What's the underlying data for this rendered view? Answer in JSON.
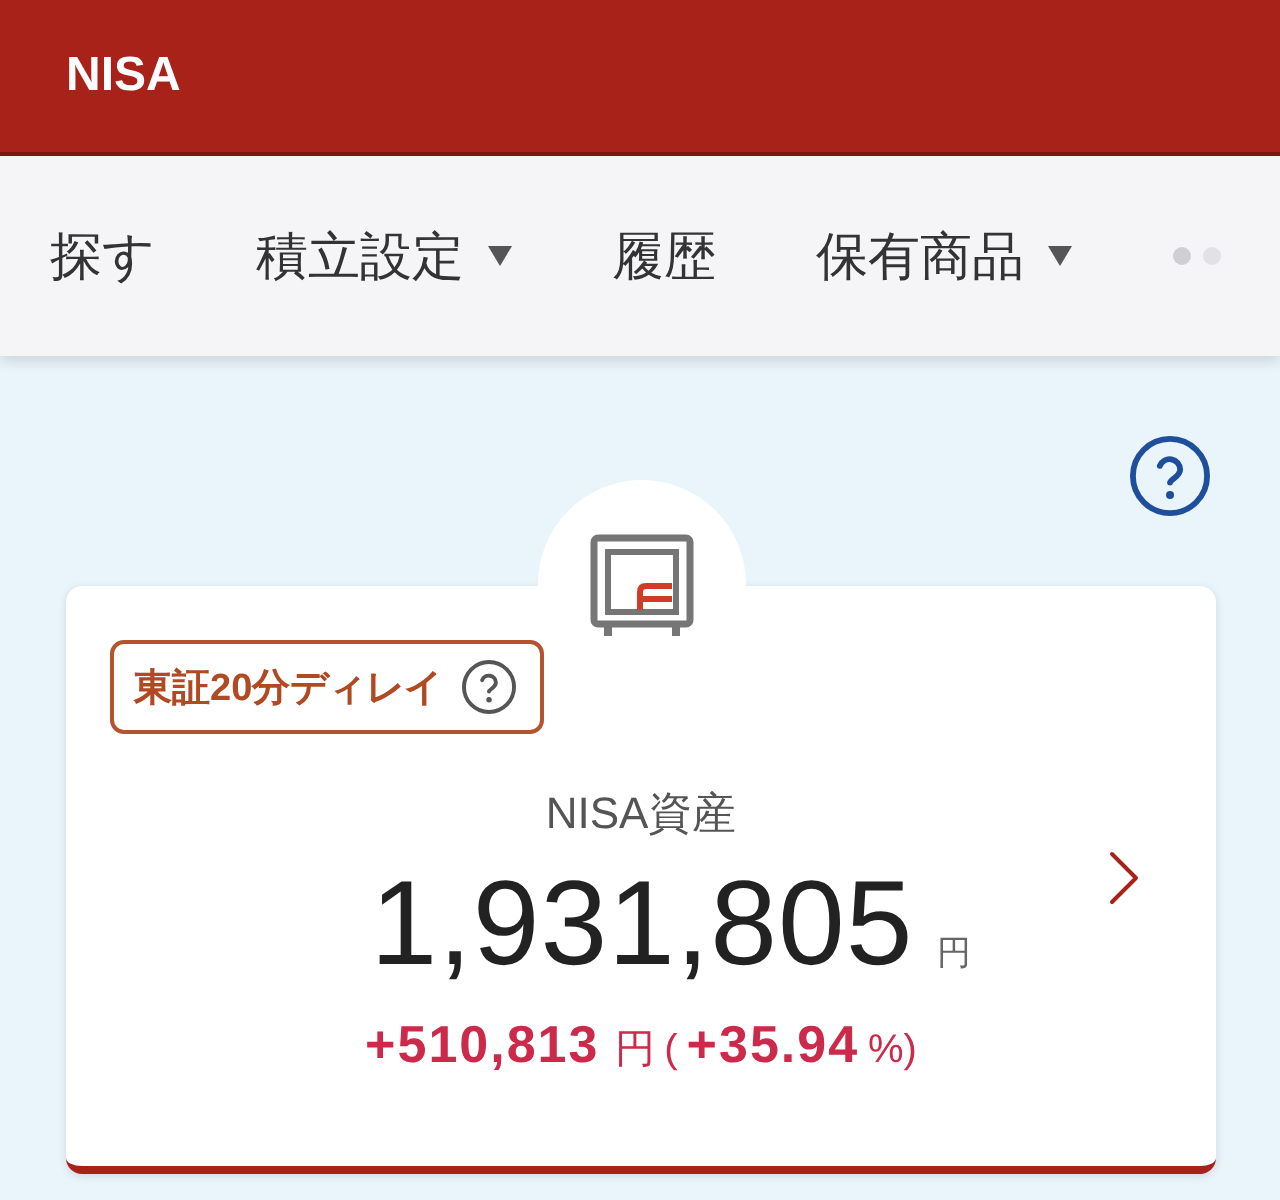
{
  "header": {
    "title": "NISA"
  },
  "tabs": [
    {
      "label": "探す",
      "dropdown": false
    },
    {
      "label": "積立設定",
      "dropdown": true
    },
    {
      "label": "履歴",
      "dropdown": false
    },
    {
      "label": "保有商品",
      "dropdown": true
    }
  ],
  "asset_card": {
    "delay_badge": "東証20分ディレイ",
    "title": "NISA資産",
    "amount": "1,931,805",
    "amount_unit": "円",
    "change": [
      {
        "kind": "number",
        "text": "+510,813"
      },
      {
        "kind": "unit",
        "text": "円"
      },
      {
        "kind": "unit",
        "text": "("
      },
      {
        "kind": "number",
        "text": "+35.94"
      },
      {
        "kind": "unit",
        "text": "%)"
      }
    ]
  }
}
